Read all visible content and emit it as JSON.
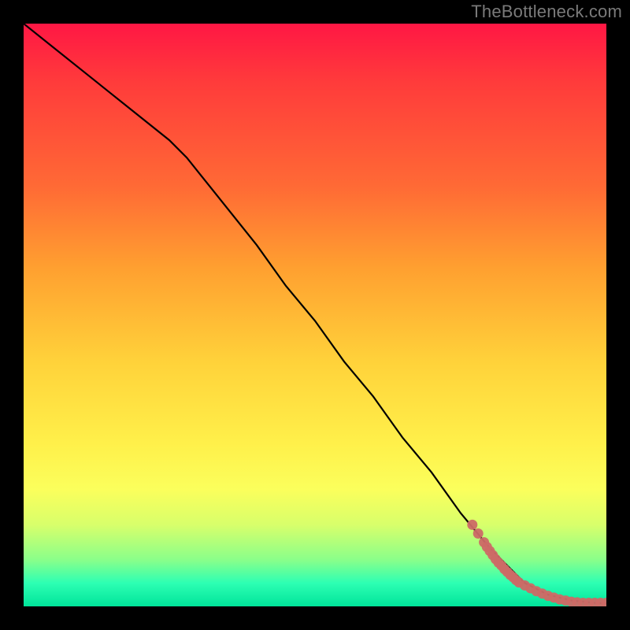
{
  "watermark": "TheBottleneck.com",
  "chart_data": {
    "type": "line",
    "title": "",
    "xlabel": "",
    "ylabel": "",
    "xlim": [
      0,
      100
    ],
    "ylim": [
      0,
      100
    ],
    "grid": false,
    "series": [
      {
        "name": "curve",
        "style": "line",
        "color": "#000000",
        "x": [
          0,
          5,
          10,
          15,
          20,
          25,
          28,
          32,
          36,
          40,
          45,
          50,
          55,
          60,
          65,
          70,
          75,
          80,
          82,
          84,
          86,
          88,
          90,
          92,
          94,
          96,
          98,
          100
        ],
        "y": [
          100,
          96,
          92,
          88,
          84,
          80,
          77,
          72,
          67,
          62,
          55,
          49,
          42,
          36,
          29,
          23,
          16,
          10,
          8,
          6,
          4,
          3,
          2,
          1.5,
          1,
          0.8,
          0.6,
          0.5
        ]
      },
      {
        "name": "points",
        "style": "scatter",
        "color": "#cc6a66",
        "x": [
          77,
          78,
          79,
          79.5,
          80,
          80.5,
          81,
          81.5,
          82,
          82.5,
          83,
          83.5,
          84,
          84.5,
          85,
          86,
          87,
          88,
          89,
          90,
          91,
          92,
          93,
          94,
          95,
          96,
          97,
          98,
          99,
          100
        ],
        "y": [
          14,
          12.5,
          11,
          10.2,
          9.5,
          8.8,
          8.1,
          7.5,
          7,
          6.4,
          5.9,
          5.4,
          5,
          4.5,
          4.1,
          3.6,
          3.1,
          2.6,
          2.2,
          1.8,
          1.5,
          1.2,
          1.0,
          0.8,
          0.7,
          0.6,
          0.6,
          0.6,
          0.6,
          0.6
        ]
      }
    ],
    "legend": false
  }
}
